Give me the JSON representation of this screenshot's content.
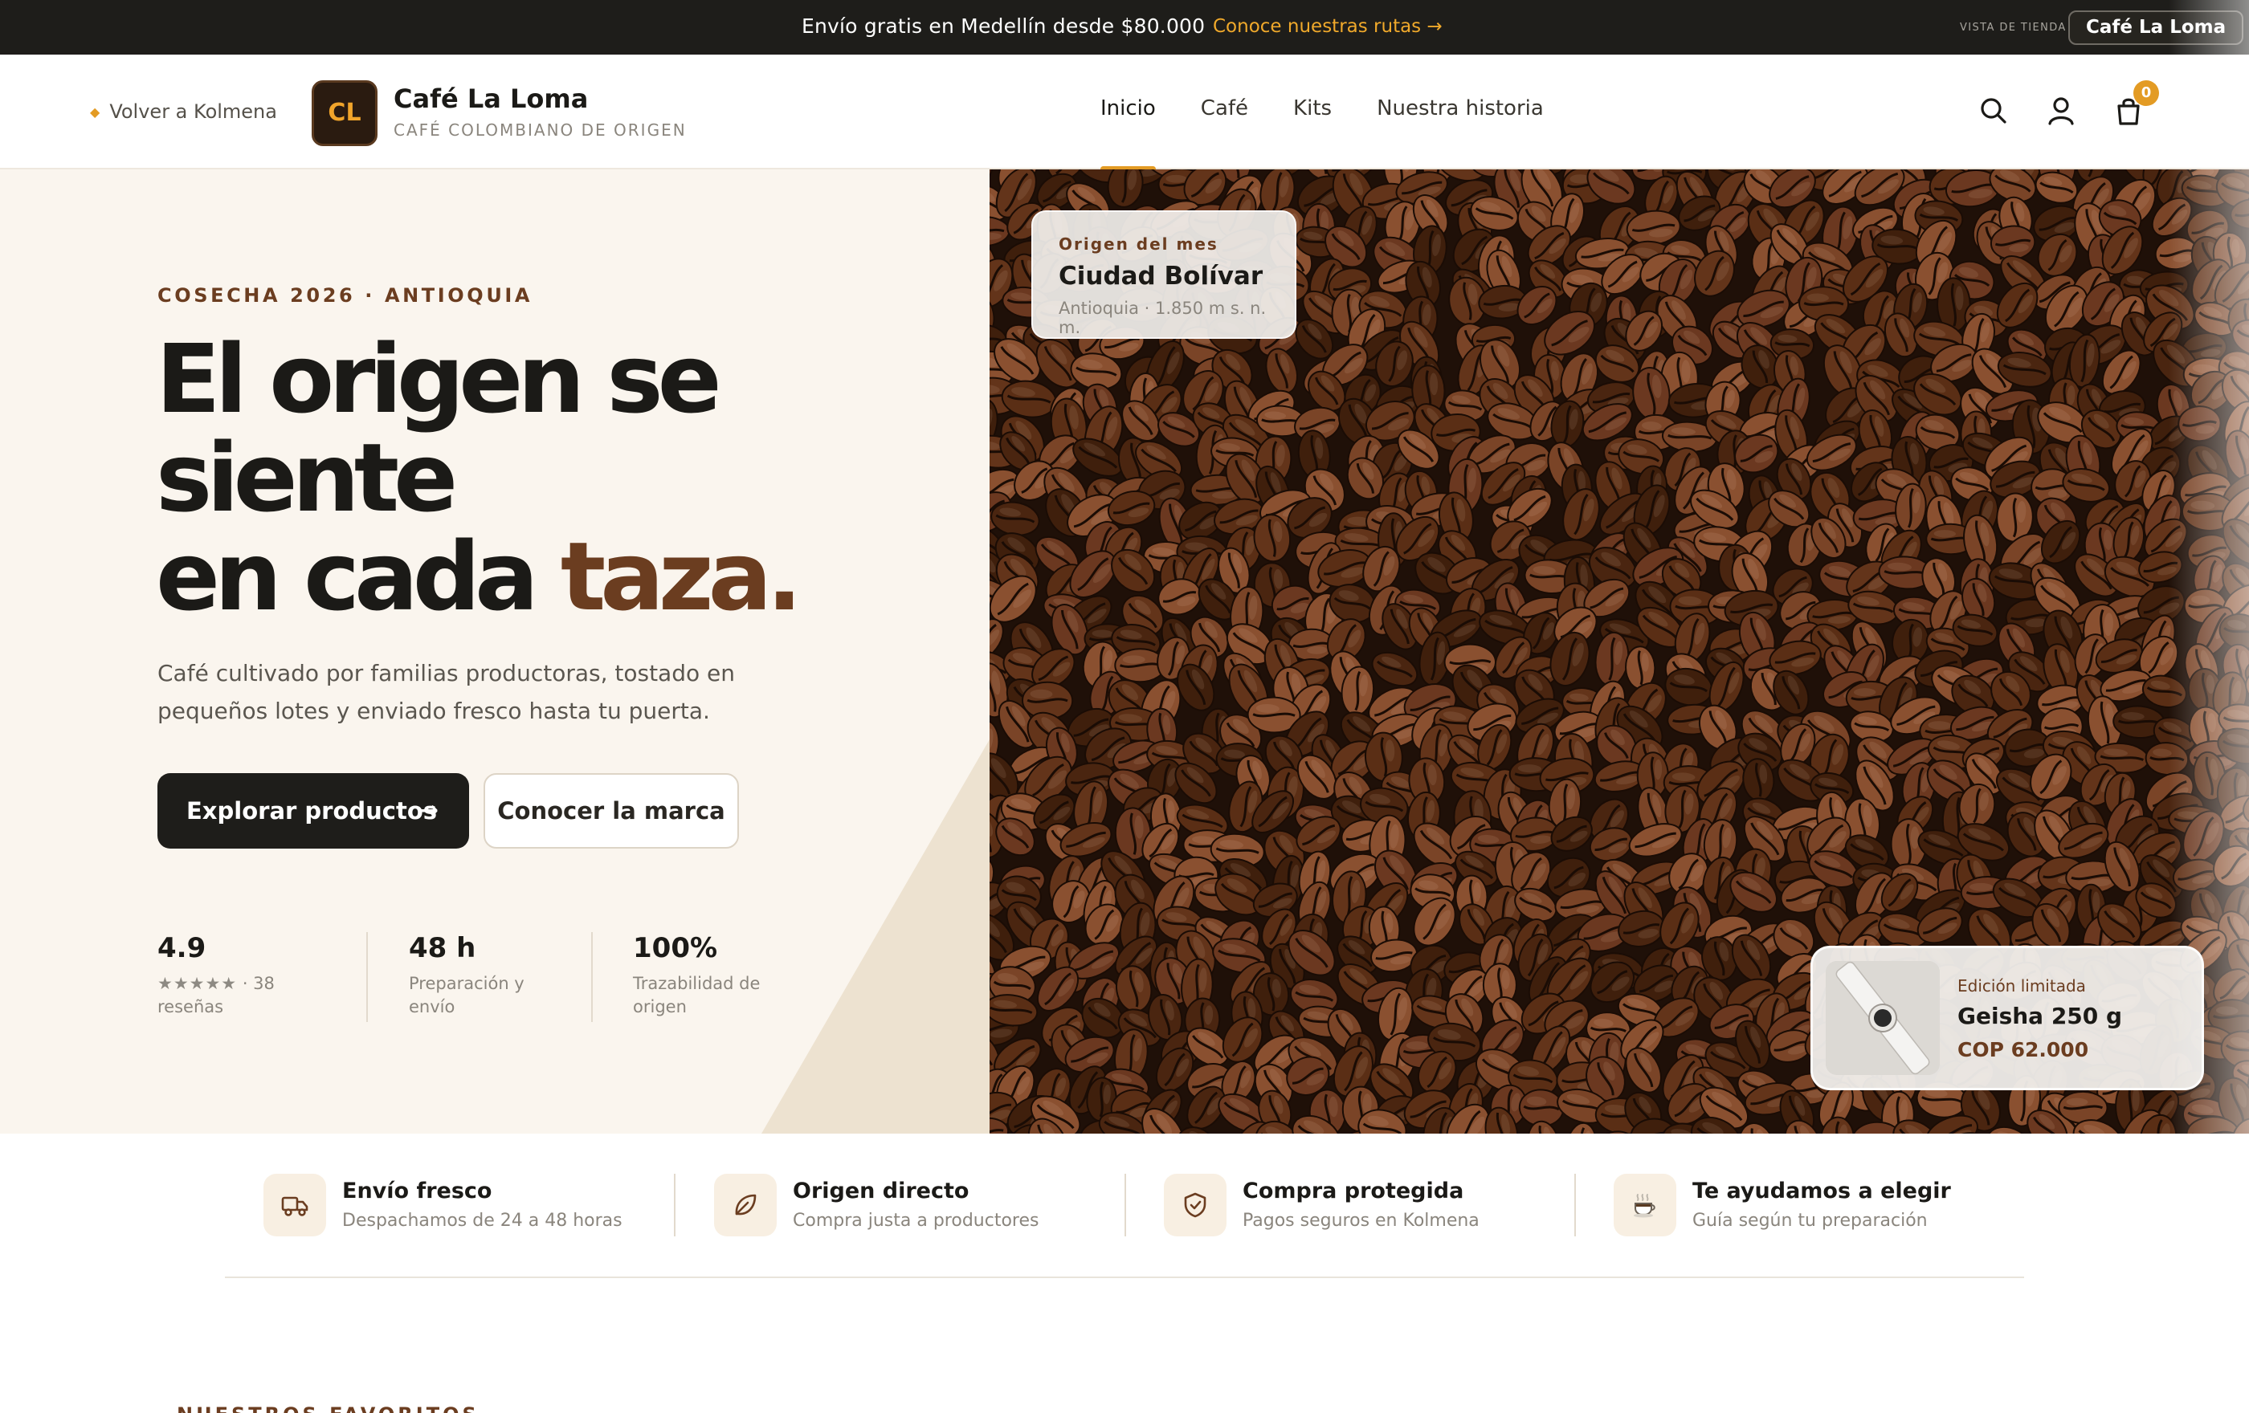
{
  "topbar": {
    "message": "Envío gratis en Medellín desde $80.000",
    "link_label": "Conoce nuestras rutas",
    "link_arrow": "→",
    "store_view_label": "VISTA DE TIENDA",
    "store_name": "Café La Loma"
  },
  "header": {
    "back_label": "Volver a Kolmena",
    "logo_initials": "CL",
    "brand_name": "Café La Loma",
    "brand_tagline": "CAFÉ COLOMBIANO DE ORIGEN",
    "nav": [
      {
        "label": "Inicio",
        "active": true
      },
      {
        "label": "Café",
        "active": false
      },
      {
        "label": "Kits",
        "active": false
      },
      {
        "label": "Nuestra historia",
        "active": false
      }
    ],
    "icons": [
      "search-icon",
      "user-icon",
      "cart-icon"
    ],
    "cart_count": "0"
  },
  "hero": {
    "eyebrow": "COSECHA 2026 · ANTIOQUIA",
    "headline_line1": "El origen se",
    "headline_line2": "siente",
    "headline_line3_plain": "en cada ",
    "headline_line3_accent": "taza.",
    "lede": "Café cultivado por familias productoras, tostado en pequeños lotes y enviado fresco hasta tu puerta.",
    "primary_cta": "Explorar productos",
    "secondary_cta": "Conocer la marca",
    "stats": [
      {
        "value": "4.9",
        "stars": "★★★★★",
        "label_tail": "· 38",
        "label2": "reseñas"
      },
      {
        "value": "48 h",
        "label": "Preparación y envío"
      },
      {
        "value": "100%",
        "label": "Trazabilidad de origen"
      }
    ]
  },
  "origin_card": {
    "kicker": "Origen del mes",
    "title": "Ciudad Bolívar",
    "subtitle": "Antioquia · 1.850 m s. n. m."
  },
  "product_card": {
    "kicker": "Edición limitada",
    "name": "Geisha 250 g",
    "price": "COP 62.000"
  },
  "features": [
    {
      "title": "Envío fresco",
      "subtitle": "Despachamos de 24 a 48 horas",
      "icon": "truck-icon"
    },
    {
      "title": "Origen directo",
      "subtitle": "Compra justa a productores",
      "icon": "leaf-icon"
    },
    {
      "title": "Compra protegida",
      "subtitle": "Pagos seguros en Kolmena",
      "icon": "shield-check-icon"
    },
    {
      "title": "Te ayudamos a elegir",
      "subtitle": "Guía según tu preparación",
      "icon": "coffee-cup-icon"
    }
  ],
  "next_section_eyebrow": "NUESTROS FAVORITOS",
  "colors": {
    "accent": "#e39b24",
    "brand_brown": "#6b3d20",
    "dark": "#1e1d1a",
    "hero_bg": "#faf5ee"
  }
}
